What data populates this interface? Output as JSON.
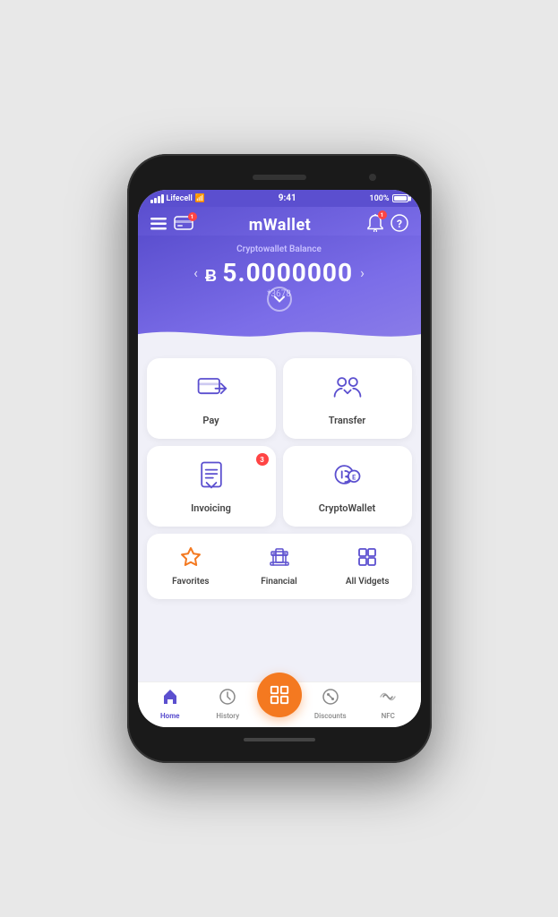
{
  "phone": {
    "status_bar": {
      "carrier": "Lifecell",
      "wifi": true,
      "time": "9:41",
      "battery": "100%"
    },
    "header": {
      "title": "mWallet",
      "notification_badge": "1"
    },
    "balance": {
      "label": "Cryptowallet Balance",
      "currency_symbol": "B",
      "amount": "5.0000000",
      "account": "*3678"
    },
    "grid": {
      "row1": [
        {
          "id": "pay",
          "label": "Pay",
          "badge": null
        },
        {
          "id": "transfer",
          "label": "Transfer",
          "badge": null
        }
      ],
      "row2": [
        {
          "id": "invoicing",
          "label": "Invoicing",
          "badge": "3"
        },
        {
          "id": "cryptowallet",
          "label": "CryptoWallet",
          "badge": null
        }
      ]
    },
    "bottom_actions": [
      {
        "id": "favorites",
        "label": "Favorites"
      },
      {
        "id": "financial",
        "label": "Financial"
      },
      {
        "id": "all_vidgets",
        "label": "All Vidgets"
      }
    ],
    "bottom_nav": [
      {
        "id": "home",
        "label": "Home",
        "active": true
      },
      {
        "id": "history",
        "label": "History",
        "active": false
      },
      {
        "id": "scan",
        "label": "",
        "active": false,
        "center": true
      },
      {
        "id": "discounts",
        "label": "Discounts",
        "active": false
      },
      {
        "id": "nfc",
        "label": "NFC",
        "active": false
      }
    ]
  }
}
